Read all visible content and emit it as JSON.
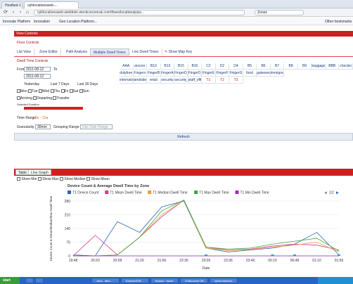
{
  "browser": {
    "tab_labels": [
      "Hostfast-1",
      "cphlocationsweb-..."
    ],
    "url": "cphlocationsweb-wieldmin.electiconomrak.com/flows/locationalyiss...",
    "search_text": "Zones",
    "bookmarks": [
      "Innovate Platform",
      "Innovation",
      "Geo Location Platform..."
    ],
    "bookmarks_right": "Other bookmarks"
  },
  "app": {
    "title": "View Controls",
    "floor_controls": "Floor Controls",
    "nav_tabs": [
      "List View",
      "Zone Editor",
      "Path Analysis",
      "Multiple Dwell Times",
      "Live Dwell Times"
    ],
    "show_map": "Show Map Key",
    "dwell_controls": "Dwell Time Controls",
    "from_label": "From",
    "from_value": "2011-08-12",
    "to_label": "To",
    "to_value": "2011-08-12",
    "quick_links": [
      "Yesterday",
      "Last 7 Days",
      "Last 30 Days"
    ],
    "days": [
      "Mon",
      "Tue",
      "Wed",
      "Thu",
      "Fri",
      "Sat",
      "Sun"
    ],
    "direction": [
      "Arriving",
      "Departing",
      "Transfer"
    ],
    "selected_label": "Selected Duration",
    "time_range_label": "Time Range",
    "time_range_value": "8a - 10a",
    "interval_label": "Granularity",
    "interval_value": "30min",
    "grouping_label": "Grouping Range",
    "grouping_value": "Use Date Range",
    "refresh": "Refresh",
    "zone_rows": [
      [
        "AAA",
        "ancore",
        "B10",
        "B13",
        "B15",
        "B16",
        "C2",
        "D2",
        "D4",
        "B5",
        "B6",
        "B7",
        "B8",
        "B9",
        "baggage",
        "BBB",
        "checkin"
      ],
      [
        "dutyfree",
        "Fingers",
        "FingerB",
        "FingerA",
        "FingerD_1",
        "FingerD_2",
        "FingerE",
        "FingerF",
        "FingerG",
        "food",
        "gatearea",
        "immigration"
      ],
      [
        "international",
        "landside",
        "retail",
        "security",
        "security_can",
        "staff_office",
        "T1",
        "T2",
        "T3"
      ]
    ]
  },
  "inner_tabs": [
    "Table",
    "Line Graph"
  ],
  "chart_options": [
    "Show Min",
    "Show Max",
    "Show Median",
    "Show Mean"
  ],
  "colors": {
    "brand_red": "#cc1f1f",
    "s1": "#2f63b5",
    "s2": "#d93a8a",
    "s3": "#f0a030",
    "s4": "#3aa83a",
    "s5": "#9a30b8",
    "s6": "#2aa0c8"
  },
  "chart_data": {
    "type": "line",
    "title": "Device Count & Average Dwell Time by Zone",
    "xlabel": "Date",
    "ylabel": "Device Count & Mean/Median/Max Dwell Time",
    "ylim": [
      0,
      280
    ],
    "yticks": [
      0,
      70,
      140,
      210,
      280
    ],
    "x": [
      "19:48",
      "20:20",
      "20:58",
      "21:26",
      "21:56",
      "22:35",
      "23:05",
      "23:36",
      "23:46",
      "00:15",
      "00:48",
      "01:10",
      "01:56"
    ],
    "legend_page": "1/2",
    "series": [
      {
        "name": "T1 Device Count",
        "color": "#2f63b5",
        "values": [
          5,
          0,
          175,
          120,
          250,
          280,
          40,
          20,
          30,
          40,
          60,
          120,
          5
        ]
      },
      {
        "name": "T1 Mean Dwell Time",
        "color": "#d93a8a",
        "values": [
          0,
          105,
          5,
          95,
          200,
          285,
          45,
          30,
          35,
          50,
          60,
          55,
          30
        ]
      },
      {
        "name": "T1 Median Dwell Time",
        "color": "#f0a030",
        "values": [
          0,
          0,
          5,
          95,
          210,
          285,
          40,
          28,
          32,
          45,
          55,
          70,
          20
        ]
      },
      {
        "name": "T1 Max Dwell Time",
        "color": "#3aa83a",
        "values": [
          0,
          0,
          5,
          95,
          230,
          285,
          45,
          35,
          40,
          60,
          75,
          90,
          25
        ]
      },
      {
        "name": "T1 Min Dwell Time",
        "color": "#9a30b8",
        "values": [
          0,
          0,
          0,
          0,
          0,
          0,
          0,
          0,
          0,
          0,
          0,
          0,
          0
        ]
      }
    ]
  },
  "taskbar": {
    "start": "start",
    "items": [
      "",
      "",
      "Java - Micr...",
      "Eclipse/ATB...",
      "Builds/~ dwell...",
      "3 Microsoft Off...",
      "cphlocationsw..."
    ]
  }
}
